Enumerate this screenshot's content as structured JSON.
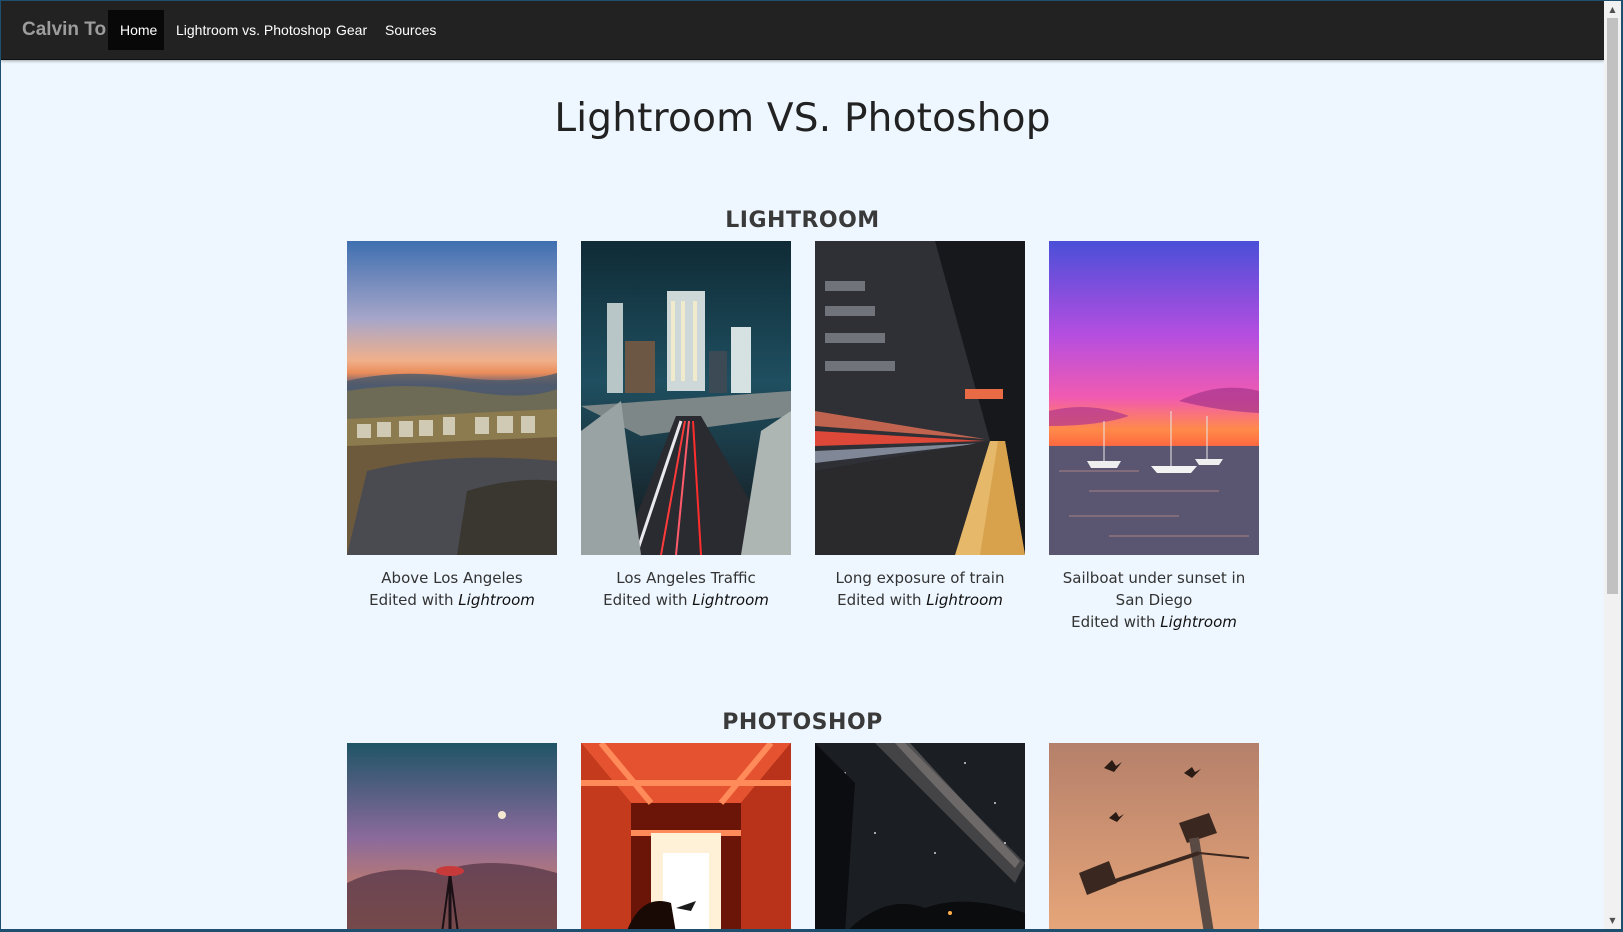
{
  "navbar": {
    "brand": "Calvin To",
    "items": [
      {
        "label": "Home",
        "active": true
      },
      {
        "label": "Lightroom vs. Photoshop",
        "active": false
      },
      {
        "label": "Gear",
        "active": false
      },
      {
        "label": "Sources",
        "active": false
      }
    ]
  },
  "page": {
    "title": "Lightroom VS. Photoshop"
  },
  "sections": {
    "lightroom": {
      "heading": "LIGHTROOM",
      "cards": [
        {
          "title": "Above Los Angeles",
          "edited_prefix": "Edited with",
          "tool": "Lightroom"
        },
        {
          "title": "Los Angeles Traffic",
          "edited_prefix": "Edited with",
          "tool": "Lightroom"
        },
        {
          "title": "Long exposure of train",
          "edited_prefix": "Edited with",
          "tool": "Lightroom"
        },
        {
          "title": "Sailboat under sunset in San Diego",
          "edited_prefix": "Edited with",
          "tool": "Lightroom"
        }
      ]
    },
    "photoshop": {
      "heading": "PHOTOSHOP"
    }
  },
  "colors": {
    "navbar_bg": "#222222",
    "active_nav_bg": "#080808",
    "page_bg": "#eef7ff"
  }
}
